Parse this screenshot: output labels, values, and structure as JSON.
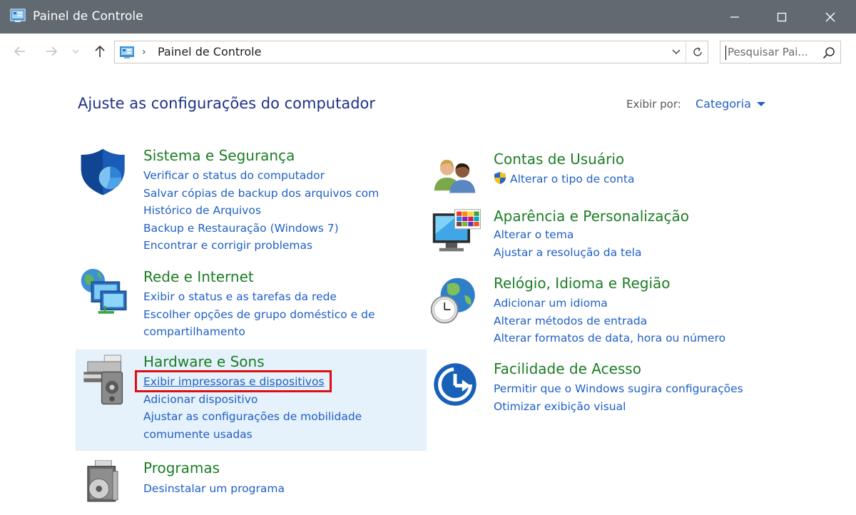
{
  "window": {
    "title": "Painel de Controle"
  },
  "address": {
    "path": "Painel de Controle",
    "separator": "›"
  },
  "search": {
    "placeholder": "Pesquisar Pai..."
  },
  "page": {
    "title": "Ajuste as configurações do computador",
    "view_by_label": "Exibir por:",
    "view_by_value": "Categoria"
  },
  "categories": {
    "system": {
      "title": "Sistema e Segurança",
      "links": [
        "Verificar o status do computador",
        "Salvar cópias de backup dos arquivos com",
        "Histórico de Arquivos",
        "Backup e Restauração (Windows 7)",
        "Encontrar e corrigir problemas"
      ]
    },
    "network": {
      "title": "Rede e Internet",
      "links": [
        "Exibir o status e as tarefas da rede",
        "Escolher opções de grupo doméstico e de",
        "compartilhamento"
      ]
    },
    "hardware": {
      "title": "Hardware e Sons",
      "links": [
        "Exibir impressoras e dispositivos",
        "Adicionar dispositivo",
        "Ajustar as configurações de mobilidade",
        "comumente usadas"
      ]
    },
    "programs": {
      "title": "Programas",
      "links": [
        "Desinstalar um programa"
      ]
    },
    "accounts": {
      "title": "Contas de Usuário",
      "links": [
        "Alterar o tipo de conta"
      ]
    },
    "appearance": {
      "title": "Aparência e Personalização",
      "links": [
        "Alterar o tema",
        "Ajustar a resolução da tela"
      ]
    },
    "clock": {
      "title": "Relógio, Idioma e Região",
      "links": [
        "Adicionar um idioma",
        "Alterar métodos de entrada",
        "Alterar formatos de data, hora ou número"
      ]
    },
    "access": {
      "title": "Facilidade de Acesso",
      "links": [
        "Permitir que o Windows sugira configurações",
        "Otimizar exibição visual"
      ]
    }
  },
  "colors": {
    "titlebar": "#616a70",
    "category_title": "#1c7d25",
    "link": "#1f5fc5",
    "heading": "#1e3287",
    "highlight": "#e5f1fb",
    "annotation_box": "#e00d14"
  },
  "icons": {
    "app": "control-panel-icon",
    "back": "arrow-left-icon",
    "forward": "arrow-right-icon",
    "recent": "chevron-down-icon",
    "up": "arrow-up-icon",
    "refresh": "refresh-icon",
    "search": "search-icon",
    "minimize": "minimize-icon",
    "maximize": "maximize-icon",
    "close": "close-icon"
  }
}
